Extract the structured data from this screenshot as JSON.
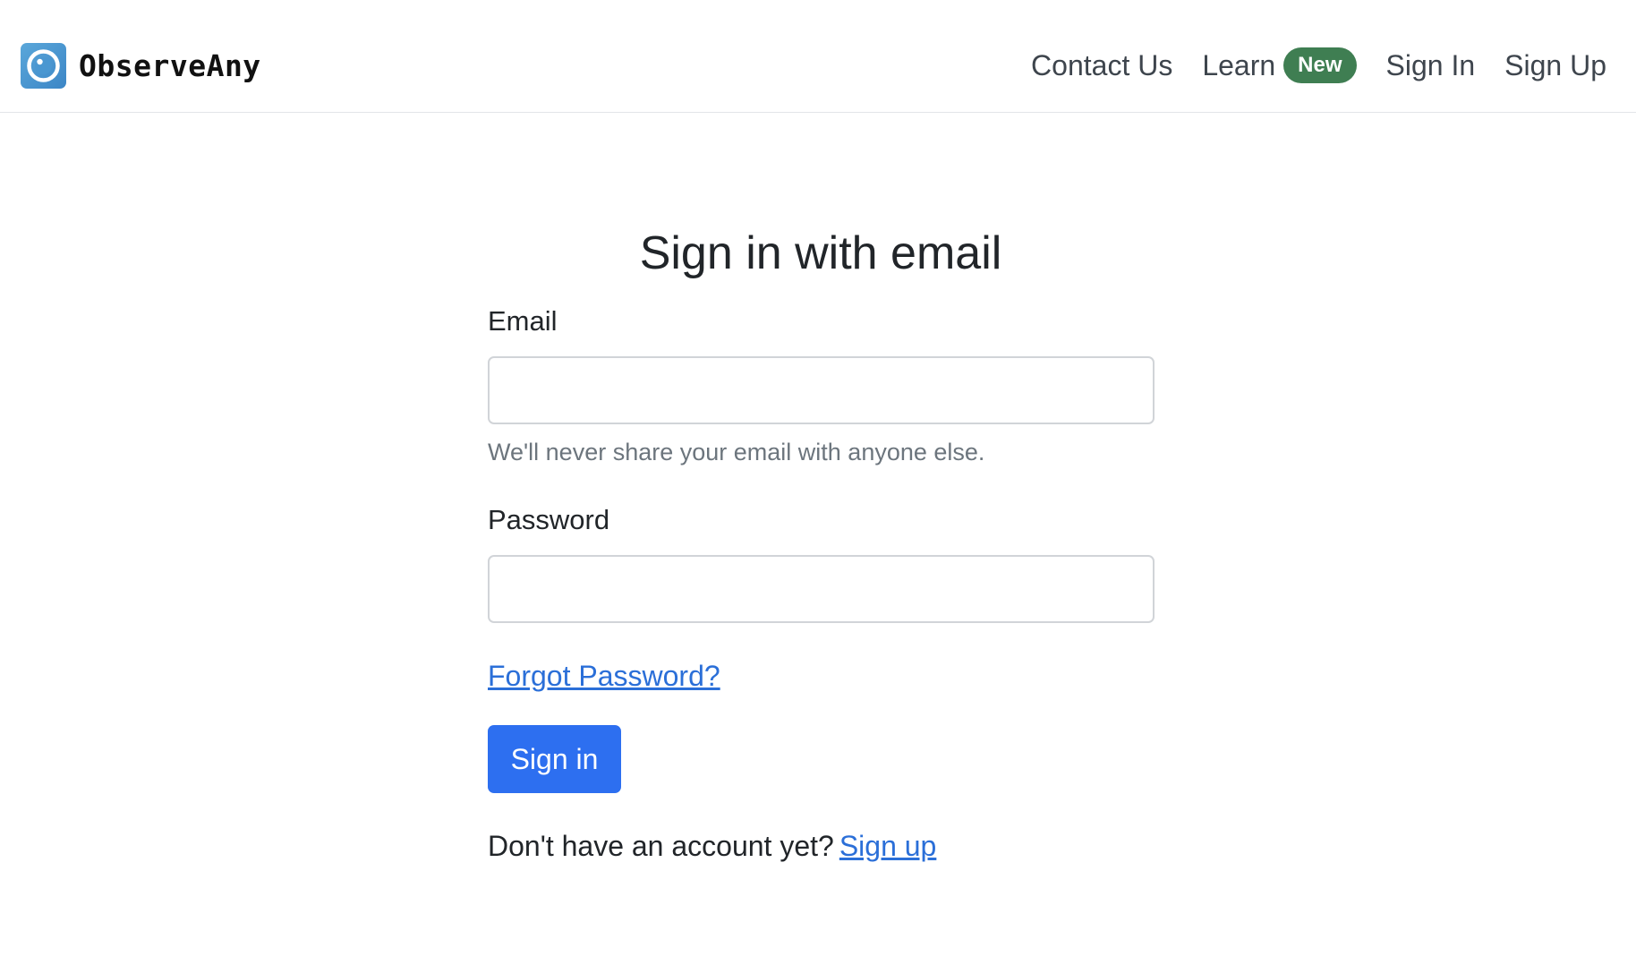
{
  "brand": {
    "name": "ObserveAny",
    "logo_icon": "eye-camera-icon",
    "logo_color": "#4a97d1"
  },
  "nav": {
    "contact": "Contact Us",
    "learn": "Learn",
    "learn_badge": "New",
    "sign_in": "Sign In",
    "sign_up": "Sign Up",
    "badge_color": "#3f7e52"
  },
  "form": {
    "title": "Sign in with email",
    "email_label": "Email",
    "email_value": "",
    "email_help": "We'll never share your email with anyone else.",
    "password_label": "Password",
    "password_value": "",
    "forgot_password": "Forgot Password?",
    "submit_label": "Sign in",
    "submit_color": "#2d6ff0",
    "no_account_text": "Don't have an account yet?",
    "signup_link": "Sign up"
  }
}
